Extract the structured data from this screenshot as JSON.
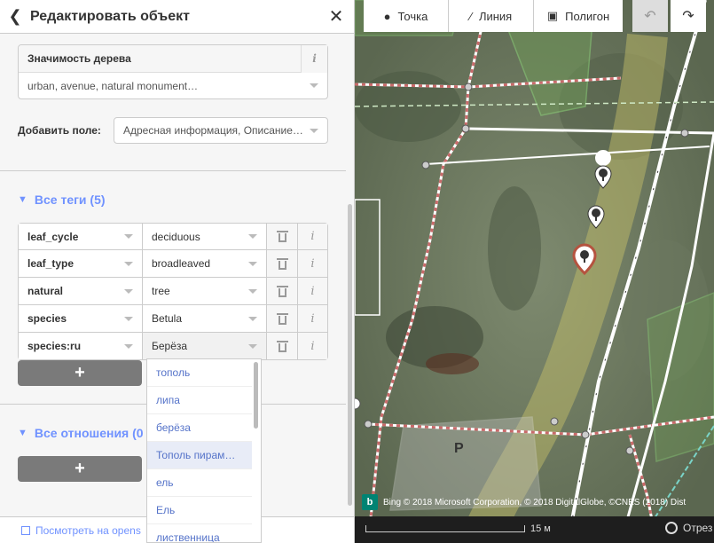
{
  "header": {
    "title": "Редактировать объект",
    "back_icon": "chevron-left-icon",
    "close_icon": "close-icon"
  },
  "significance_field": {
    "label": "Значимость дерева",
    "value": "urban, avenue, natural monument…"
  },
  "add_field": {
    "label": "Добавить поле:",
    "value": "Адресная информация, Описание…"
  },
  "all_tags": {
    "title": "Все теги (5)",
    "rows": [
      {
        "key": "leaf_cycle",
        "value": "deciduous"
      },
      {
        "key": "leaf_type",
        "value": "broadleaved"
      },
      {
        "key": "natural",
        "value": "tree"
      },
      {
        "key": "species",
        "value": "Betula"
      },
      {
        "key": "species:ru",
        "value": "Берёза"
      }
    ],
    "add_label": "+"
  },
  "relations": {
    "title": "Все отношения (0",
    "add_label": "+"
  },
  "dropdown": {
    "options": [
      "тополь",
      "липа",
      "берёза",
      "Тополь пирам…",
      "ель",
      "Ель",
      "лиственница"
    ],
    "highlighted_index": 3
  },
  "footer": {
    "link": "Посмотреть на opens"
  },
  "toolbar": {
    "point": "Точка",
    "line": "Линия",
    "polygon": "Полигон",
    "undo_icon": "undo-icon",
    "redo_icon": "redo-icon"
  },
  "map": {
    "attribution": "Bing © 2018 Microsoft Corporation, © 2018 DigitalGlobe, ©CNES (2018) Dist",
    "parking_label": "P",
    "scale_label": "15 м",
    "measure_label": "Отрез"
  },
  "colors": {
    "accent": "#7092ff",
    "button_gray": "#7a7a7a",
    "selected_marker": "#b5533f"
  }
}
